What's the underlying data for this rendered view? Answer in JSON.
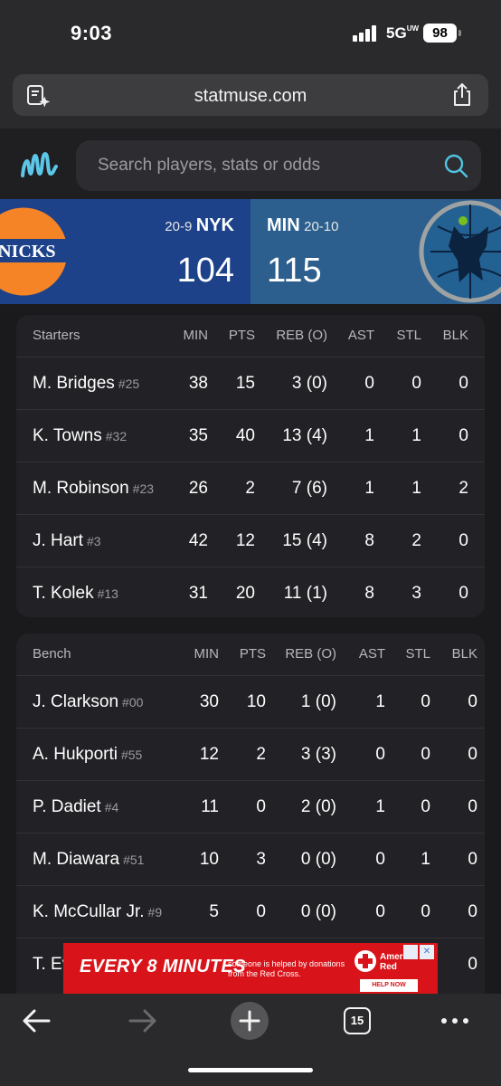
{
  "status_bar": {
    "time": "9:03",
    "network": "5G",
    "network_sub": "UW",
    "battery": "98"
  },
  "browser": {
    "url": "statmuse.com",
    "tab_count": "15"
  },
  "search": {
    "placeholder": "Search players, stats or odds"
  },
  "game": {
    "home": {
      "record": "20-9",
      "abbr": "NYK",
      "score": "104",
      "color": "#1d428a"
    },
    "away": {
      "abbr": "MIN",
      "record": "20-10",
      "score": "115",
      "color": "#2c5f8e"
    }
  },
  "starters": {
    "header": [
      "Starters",
      "MIN",
      "PTS",
      "REB (O)",
      "AST",
      "STL",
      "BLK"
    ],
    "rows": [
      {
        "name": "M. Bridges",
        "num": "#25",
        "min": "38",
        "pts": "15",
        "reb": "3 (0)",
        "ast": "0",
        "stl": "0",
        "blk": "0"
      },
      {
        "name": "K. Towns",
        "num": "#32",
        "min": "35",
        "pts": "40",
        "reb": "13 (4)",
        "ast": "1",
        "stl": "1",
        "blk": "0"
      },
      {
        "name": "M. Robinson",
        "num": "#23",
        "min": "26",
        "pts": "2",
        "reb": "7 (6)",
        "ast": "1",
        "stl": "1",
        "blk": "2"
      },
      {
        "name": "J. Hart",
        "num": "#3",
        "min": "42",
        "pts": "12",
        "reb": "15 (4)",
        "ast": "8",
        "stl": "2",
        "blk": "0"
      },
      {
        "name": "T. Kolek",
        "num": "#13",
        "min": "31",
        "pts": "20",
        "reb": "11 (1)",
        "ast": "8",
        "stl": "3",
        "blk": "0"
      }
    ]
  },
  "bench": {
    "header": [
      "Bench",
      "MIN",
      "PTS",
      "REB (O)",
      "AST",
      "STL",
      "BLK"
    ],
    "rows": [
      {
        "name": "J. Clarkson",
        "num": "#00",
        "min": "30",
        "pts": "10",
        "reb": "1 (0)",
        "ast": "1",
        "stl": "0",
        "blk": "0"
      },
      {
        "name": "A. Hukporti",
        "num": "#55",
        "min": "12",
        "pts": "2",
        "reb": "3 (3)",
        "ast": "0",
        "stl": "0",
        "blk": "0"
      },
      {
        "name": "P. Dadiet",
        "num": "#4",
        "min": "11",
        "pts": "0",
        "reb": "2 (0)",
        "ast": "1",
        "stl": "0",
        "blk": "0"
      },
      {
        "name": "M. Diawara",
        "num": "#51",
        "min": "10",
        "pts": "3",
        "reb": "0 (0)",
        "ast": "0",
        "stl": "1",
        "blk": "0"
      },
      {
        "name": "K. McCullar Jr.",
        "num": "#9",
        "min": "5",
        "pts": "0",
        "reb": "0 (0)",
        "ast": "0",
        "stl": "0",
        "blk": "0"
      },
      {
        "name": "T. Ev",
        "num": "",
        "min": "",
        "pts": "",
        "reb": "",
        "ast": "",
        "stl": "",
        "blk": "0"
      }
    ]
  },
  "ad": {
    "headline": "EVERY 8 MINUTES",
    "body": "someone is helped by donations from the Red Cross.",
    "brand": "American Red Cross",
    "cta": "HELP NOW"
  },
  "icons": [
    "reader-icon",
    "share-icon",
    "statmuse-logo",
    "search-icon",
    "back-icon",
    "forward-icon",
    "new-tab-icon",
    "tabs-icon",
    "more-icon"
  ]
}
